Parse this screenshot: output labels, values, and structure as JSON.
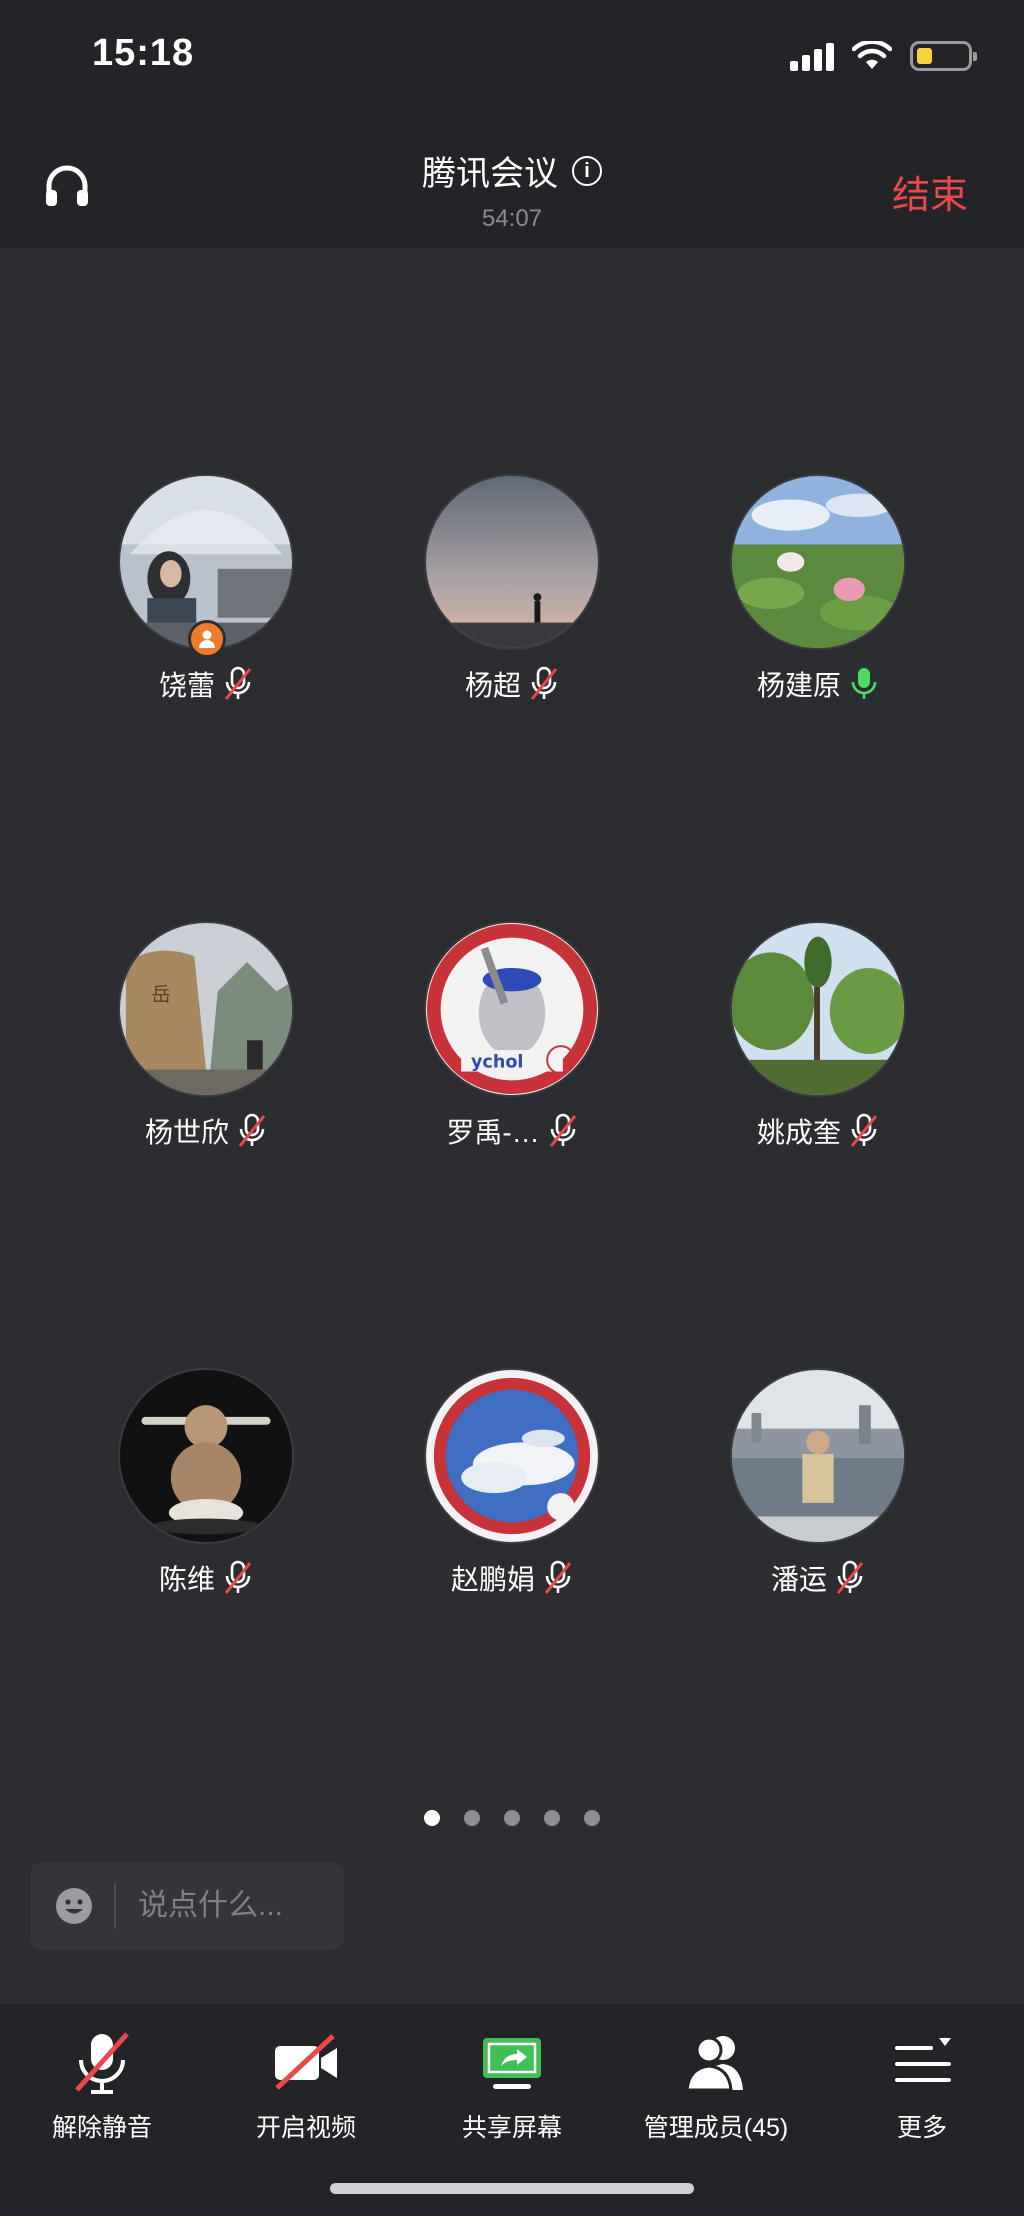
{
  "status_bar": {
    "time": "15:18",
    "battery_level": 0.3
  },
  "header": {
    "title": "腾讯会议",
    "timer": "54:07",
    "end_label": "结束"
  },
  "participants": [
    {
      "name": "饶蕾",
      "mic": "muted",
      "host": true,
      "avatar": "umbrella-woman-photo"
    },
    {
      "name": "杨超",
      "mic": "muted",
      "host": false,
      "avatar": "dusk-silhouette-photo"
    },
    {
      "name": "杨建原",
      "mic": "active",
      "host": false,
      "avatar": "lotus-photo"
    },
    {
      "name": "杨世欣",
      "mic": "muted",
      "host": false,
      "avatar": "stone-monument-photo"
    },
    {
      "name": "罗禹-…",
      "mic": "muted",
      "host": false,
      "avatar": "psychology-head-logo"
    },
    {
      "name": "姚成奎",
      "mic": "muted",
      "host": false,
      "avatar": "trees-photo"
    },
    {
      "name": "陈维",
      "mic": "muted",
      "host": false,
      "avatar": "baby-statue-photo"
    },
    {
      "name": "赵鹏娟",
      "mic": "muted",
      "host": false,
      "avatar": "clouds-stamp-photo"
    },
    {
      "name": "潘运",
      "mic": "muted",
      "host": false,
      "avatar": "harbour-man-photo"
    }
  ],
  "pager": {
    "count": 5,
    "active": 1
  },
  "chat": {
    "placeholder": "说点什么..."
  },
  "toolbar": {
    "unmute": "解除静音",
    "video": "开启视频",
    "share": "共享屏幕",
    "members": "管理成员(45)",
    "more": "更多"
  },
  "colors": {
    "accent_red": "#e84a4a",
    "mic_green": "#4cd964",
    "share_green": "#3fbf56",
    "host_orange": "#ef7b2e"
  }
}
